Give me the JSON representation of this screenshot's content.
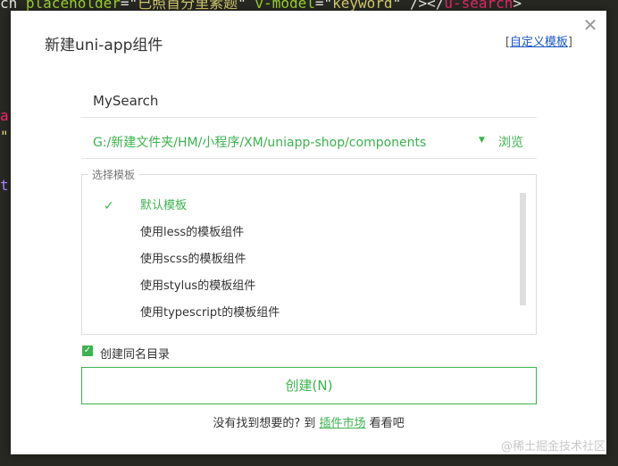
{
  "editor": {
    "code_top_parts": [
      "ch ",
      "placeholder",
      "=\"",
      "已照首分里素题",
      "\" ",
      "v-model",
      "=\"",
      "keyword",
      "\" ",
      "/>",
      "</",
      "u-search",
      ">"
    ],
    "left_glyphs": [
      "a",
      "\"",
      "t"
    ]
  },
  "dialog": {
    "title": "新建uni-app组件",
    "custom_template": {
      "open": "[",
      "label": "自定义模板",
      "close": "]"
    },
    "close_glyph": "✕",
    "name_value": "MySearch",
    "path_value": "G:/新建文件夹/HM/小程序/XM/uniapp-shop/components",
    "path_caret": "▼",
    "browse_label": "浏览",
    "template_group": {
      "legend": "选择模板",
      "items": [
        {
          "label": "默认模板",
          "selected": true,
          "check": "✓"
        },
        {
          "label": "使用less的模板组件",
          "selected": false
        },
        {
          "label": "使用scss的模板组件",
          "selected": false
        },
        {
          "label": "使用stylus的模板组件",
          "selected": false
        },
        {
          "label": "使用typescript的模板组件",
          "selected": false
        }
      ]
    },
    "same_dir": {
      "label": "创建同名目录",
      "checked": true,
      "check_glyph": "✓"
    },
    "create_button": "创建(N)",
    "footer": {
      "prefix": "没有找到想要的? 到",
      "link": "插件市场",
      "suffix": "看看吧"
    }
  },
  "watermark": "@稀土掘金技术社区",
  "colors": {
    "accent": "#3cb34f",
    "link": "#1a57c9",
    "editor_bg": "#272822"
  }
}
